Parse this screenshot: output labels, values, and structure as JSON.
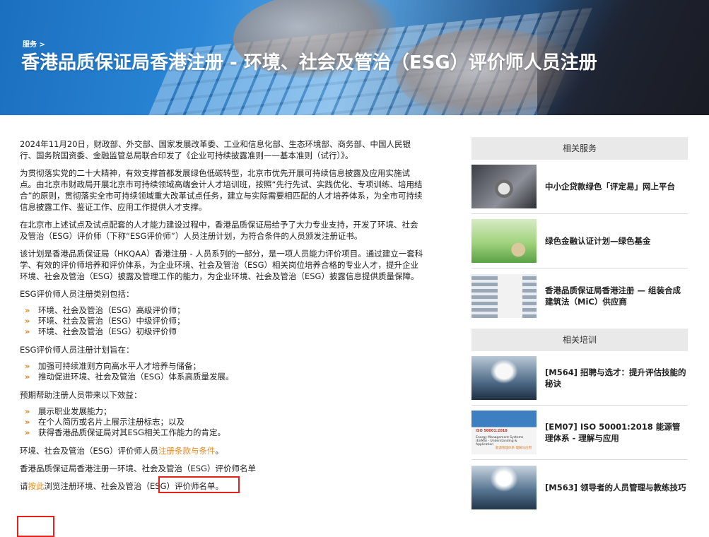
{
  "hero": {
    "breadcrumb": "服务 >",
    "title": "香港品质保证局香港注册 - 环境、社会及管治（ESG）评价师人员注册"
  },
  "main": {
    "p1": "2024年11月20日，财政部、外交部、国家发展改革委、工业和信息化部、生态环境部、商务部、中国人民银行、国务院国资委、金融监管总局联合印发了《企业可持续披露准则——基本准则（试行）》。",
    "p2": "为贯彻落实党的二十大精神，有效支撑首都发展绿色低碳转型，北京市优先开展可持续信息披露及应用实施试点。由北京市财政局开展北京市可持续领域高端会计人才培训班，按照“先行先试、实践优化、专项训练、培用结合”的原则，贯彻落实全市可持续领域重大改革试点任务，建立与实际需要相匹配的人才培养体系，为全市可持续信息披露工作、鉴证工作、应用工作提供人才支撑。",
    "p3": "在北京市上述试点及试点配套的人才能力建设过程中，香港品质保证局给予了大力专业支持，开发了环境、社会及管治（ESG）评价师（下称“ESG评价师”）人员注册计划，为符合条件的人员颁发注册证书。",
    "p4": "该计划是香港品质保证局（HKQAA）香港注册 - 人员系列的一部分，是一项人员能力评价项目。通过建立一套科学、有效的评价师培养和评价体系，为企业环境、社会及管治（ESG）相关岗位培养合格的专业人才，提升企业环境、社会及管治（ESG）披露及管理工作的能力，为企业环境、社会及管治（ESG）披露信息提供质量保障。",
    "cat_label": "ESG评价师人员注册类别包括：",
    "categories": [
      "环境、社会及管治（ESG）高级评价师；",
      "环境、社会及管治（ESG）中级评价师；",
      "环境、社会及管治（ESG）初级评价师"
    ],
    "aim_label": "ESG评价师人员注册计划旨在：",
    "aims": [
      "加强可持续准则方向高水平人才培养与储备；",
      "推动促进环境、社会及管治（ESG）体系高质量发展。"
    ],
    "benefit_label": "预期帮助注册人员带来以下效益：",
    "benefits": [
      "展示职业发展能力；",
      "在个人简历或名片上展示注册标志；以及",
      "获得香港品质保证局对其ESG相关工作能力的肯定。"
    ],
    "terms_prefix": "环境、社会及管治（ESG）评价师人员",
    "terms_link": "注册条款与条件",
    "terms_suffix": "。",
    "list_heading": "香港品质保证局香港注册—环境、社会及管治（ESG）评价师名单",
    "click_prefix": "请",
    "click_link": "按此",
    "click_suffix": "浏览注册环境、社会及管治（ESG）评价师名单。"
  },
  "sidebar": {
    "services_head": "相关服务",
    "services": [
      "中小企贷款绿色「评定易」网上平台",
      "绿色金融认证计划—绿色基金",
      "香港品质保证局香港注册 — 组装合成建筑法（MiC）供应商"
    ],
    "training_head": "相关培训",
    "trainings": [
      "[M564] 招聘与选才：提升评估技能的秘诀",
      "[EM07] ISO 50001:2018 能源管理体系 - 理解与应用",
      "[M563] 领导者的人员管理与教练技巧"
    ],
    "thumb_texts": {
      "iso_title": "ISO 50001:2018",
      "iso_sub": "Energy Management Systems (EnMS) - Understanding & Application",
      "iso_cn": "能源管理体系-理解与应用"
    }
  },
  "colors": {
    "link": "#f08a1e",
    "highlight_box": "#e3221c",
    "bullet": "#e8812c",
    "side_header_bg": "#e9e9e9"
  }
}
